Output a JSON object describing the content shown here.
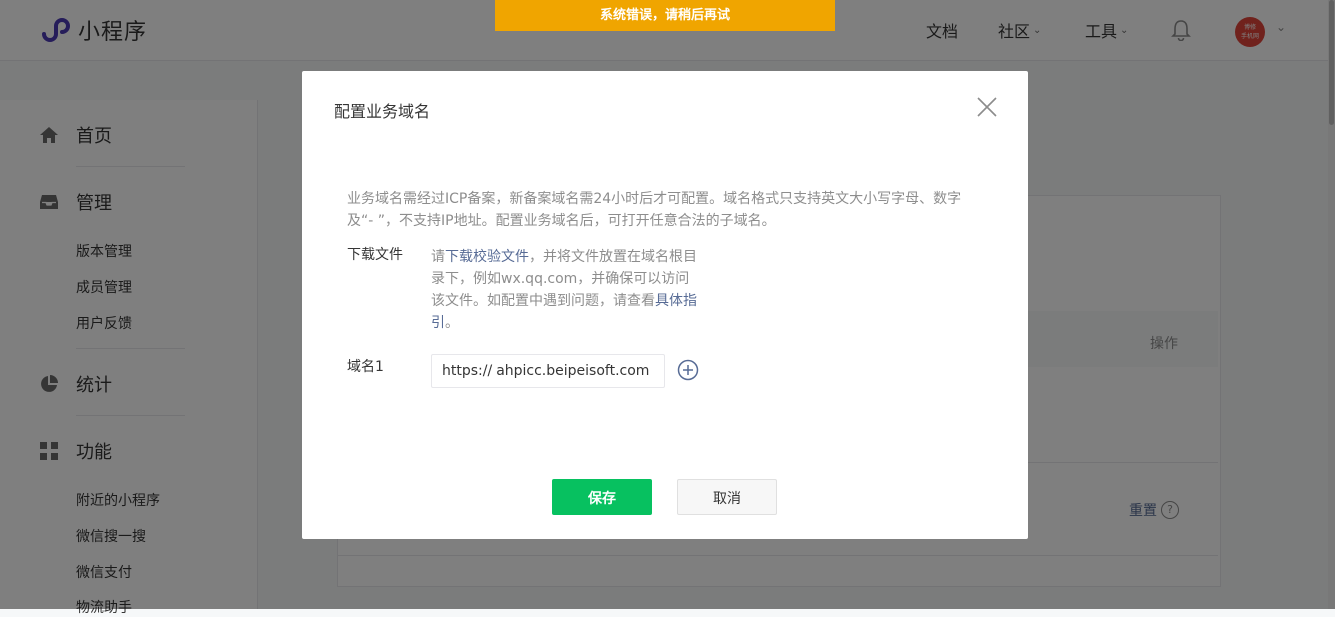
{
  "header": {
    "app_name": "小程序",
    "error_banner": "系统错误，请稍后再试",
    "nav": {
      "docs": "文档",
      "community": "社区",
      "tools": "工具"
    },
    "avatar_text": "博修\n手机网"
  },
  "sidebar": {
    "home": "首页",
    "manage": "管理",
    "manage_items": [
      "版本管理",
      "成员管理",
      "用户反馈"
    ],
    "stats": "统计",
    "features": "功能",
    "feature_items": [
      "附近的小程序",
      "微信搜一搜",
      "微信支付",
      "物流助手"
    ]
  },
  "background_panel": {
    "ops_header": "操作",
    "reset_link": "重置",
    "help_mark": "?"
  },
  "dialog": {
    "title": "配置业务域名",
    "description": "业务域名需经过ICP备案，新备案域名需24小时后才可配置。域名格式只支持英文大小写字母、数字及“- ”，不支持IP地址。配置业务域名后，可打开任意合法的子域名。",
    "download_label": "下载文件",
    "download_text_1": "请",
    "download_link": "下载校验文件",
    "download_text_2": "，并将文件放置在域名根目录下，例如wx.qq.com，并确保可以访问该文件。如配置中遇到问题，请查看",
    "guide_link": "具体指引",
    "download_text_3": "。",
    "domain_label": "域名1",
    "domain_prefix": "https://",
    "domain_value": "ahpicc.beipeisoft.com",
    "save_label": "保存",
    "cancel_label": "取消"
  },
  "colors": {
    "primary_green": "#07c160",
    "banner_orange": "#f0a500",
    "link_blue": "#576b95",
    "logo_purple": "#4c3bb5"
  },
  "icons": [
    "logo-icon",
    "bell-icon",
    "home-icon",
    "inbox-icon",
    "pie-chart-icon",
    "grid-icon",
    "close-icon",
    "add-circle-icon",
    "chevron-down-icon"
  ]
}
